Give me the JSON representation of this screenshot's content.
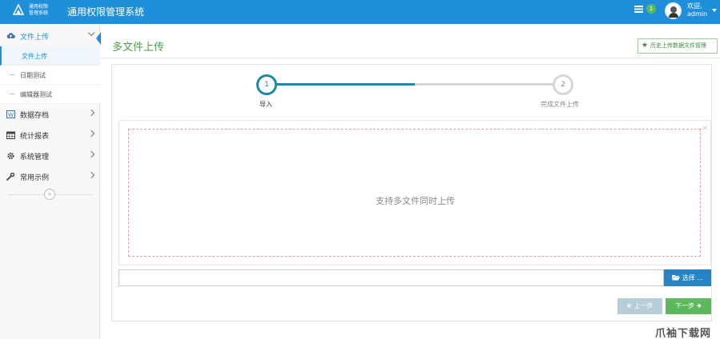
{
  "header": {
    "logo_text_line1": "通用权限",
    "logo_text_line2": "管理系统",
    "app_title": "通用权限管理系统",
    "message_count": "1",
    "welcome": "欢迎,",
    "username": "admin"
  },
  "sidebar": {
    "items": [
      {
        "label": "文件上传",
        "icon": "cloud-upload-icon"
      },
      {
        "label": "数据存档",
        "icon": "word-file-icon"
      },
      {
        "label": "统计报表",
        "icon": "calendar-icon"
      },
      {
        "label": "系统管理",
        "icon": "gear-icon"
      },
      {
        "label": "常用示例",
        "icon": "wrench-icon"
      }
    ],
    "sub_items": [
      {
        "label": "文件上传"
      },
      {
        "label": "日期测试"
      },
      {
        "label": "编辑器测试"
      }
    ],
    "collapse_glyph": "«"
  },
  "main": {
    "page_title": "多文件上传",
    "history_button": "历史上传数据文件管理",
    "steps": [
      {
        "number": "1",
        "label": "导入"
      },
      {
        "number": "2",
        "label": "完成文件上传"
      }
    ],
    "drop_text": "支持多文件同时上传",
    "close_glyph": "×",
    "choose_button": "选择 ...",
    "prev_button": "上一步",
    "next_button": "下一步"
  },
  "watermark": "爪袖下载网",
  "colors": {
    "header_bg": "#1e8fd8",
    "step_active": "#1f87a8",
    "title_green": "#4a9e4a",
    "next_green": "#5cb85c",
    "choose_blue": "#2784c4",
    "prev_disabled": "#b7cdd9"
  }
}
